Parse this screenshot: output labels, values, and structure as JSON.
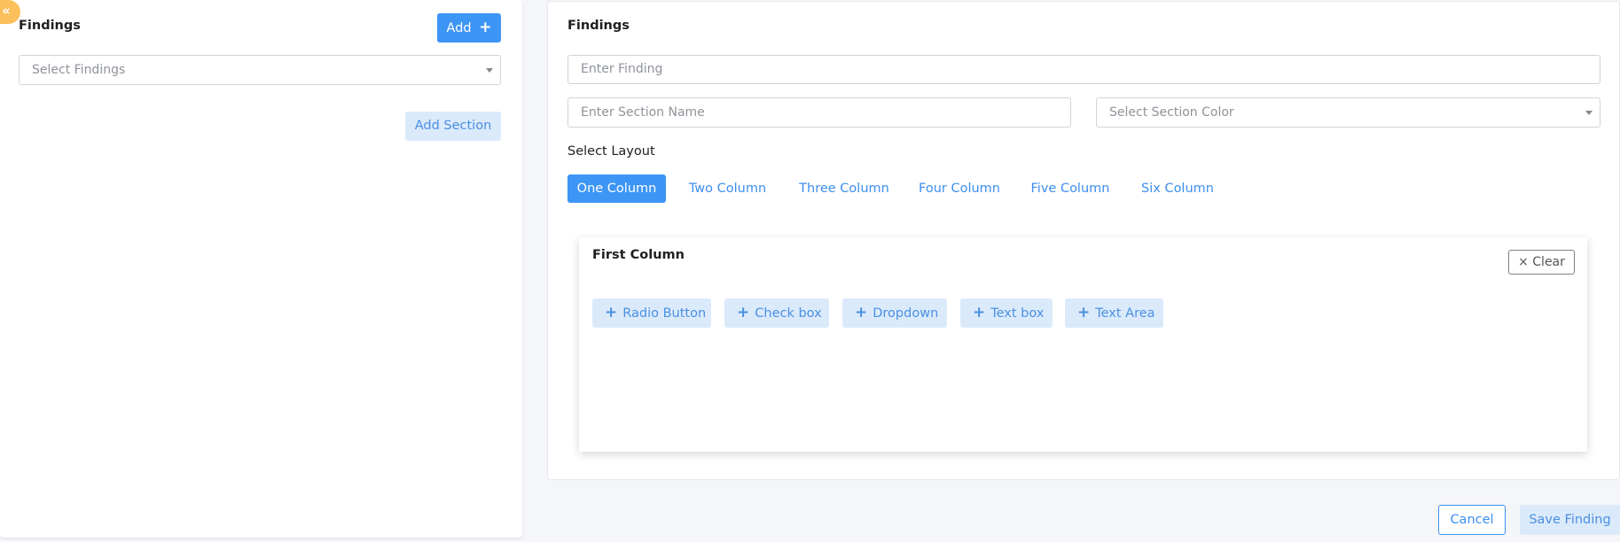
{
  "left": {
    "collapse_icon": "«",
    "title": "Findings",
    "add_label": "Add",
    "add_icon": "+",
    "select_placeholder": "Select Findings",
    "add_section_label": "Add Section"
  },
  "right": {
    "title": "Findings",
    "finding_placeholder": "Enter  Finding",
    "section_name_placeholder": "Enter Section Name",
    "section_color_placeholder": "Select Section Color",
    "layout_label": "Select Layout",
    "layouts": [
      "One Column",
      "Two Column",
      "Three Column",
      "Four Column",
      "Five Column",
      "Six Column"
    ],
    "active_layout": "One Column",
    "column": {
      "title": "First Column",
      "clear_icon": "×",
      "clear_label": "Clear",
      "fields": [
        "Radio Button",
        "Check box",
        "Dropdown",
        "Text box",
        "Text Area"
      ],
      "field_icon": "+"
    }
  },
  "footer": {
    "cancel_label": "Cancel",
    "save_label": "Save Finding"
  },
  "colors": {
    "primary": "#3d95f5",
    "soft": "#dbeafb",
    "accent_tab": "#fbbf5c"
  }
}
